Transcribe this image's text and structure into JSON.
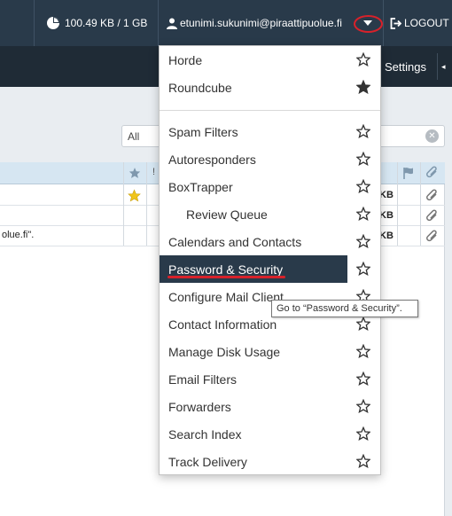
{
  "topbar": {
    "disk_usage": "100.49 KB / 1 GB",
    "user_email": "etunimi.sukunimi@piraattipuolue.fi",
    "logout_label": "LOGOUT",
    "icons": {
      "disk": "pie-chart-icon",
      "user": "user-icon",
      "caret": "caret-down-icon",
      "logout": "logout-icon"
    },
    "highlight_color": "#d8212a"
  },
  "navbar": {
    "settings_label": "Settings"
  },
  "mailbox": {
    "filter_value": "All",
    "header_star": "star-icon",
    "rows": [
      {
        "snippet": "",
        "size_unit": "KB",
        "starred": true
      },
      {
        "snippet": "",
        "size_unit": "KB",
        "starred": false
      },
      {
        "snippet": "olue.fi\".",
        "size_unit": "KB",
        "starred": false
      }
    ]
  },
  "menu": {
    "webmail": [
      {
        "label": "Horde",
        "favorite": false
      },
      {
        "label": "Roundcube",
        "favorite": true
      }
    ],
    "tools": [
      {
        "label": "Spam Filters"
      },
      {
        "label": "Autoresponders"
      },
      {
        "label": "BoxTrapper"
      },
      {
        "label": "Review Queue"
      },
      {
        "label": "Calendars and Contacts"
      },
      {
        "label": "Password & Security"
      },
      {
        "label": "Configure Mail Client"
      },
      {
        "label": "Contact Information"
      },
      {
        "label": "Manage Disk Usage"
      },
      {
        "label": "Email Filters"
      },
      {
        "label": "Forwarders"
      },
      {
        "label": "Search Index"
      },
      {
        "label": "Track Delivery"
      }
    ],
    "active_item": "Password & Security",
    "active_bg": "#293a4a"
  },
  "tooltip": {
    "text": "Go to “Password & Security”."
  }
}
